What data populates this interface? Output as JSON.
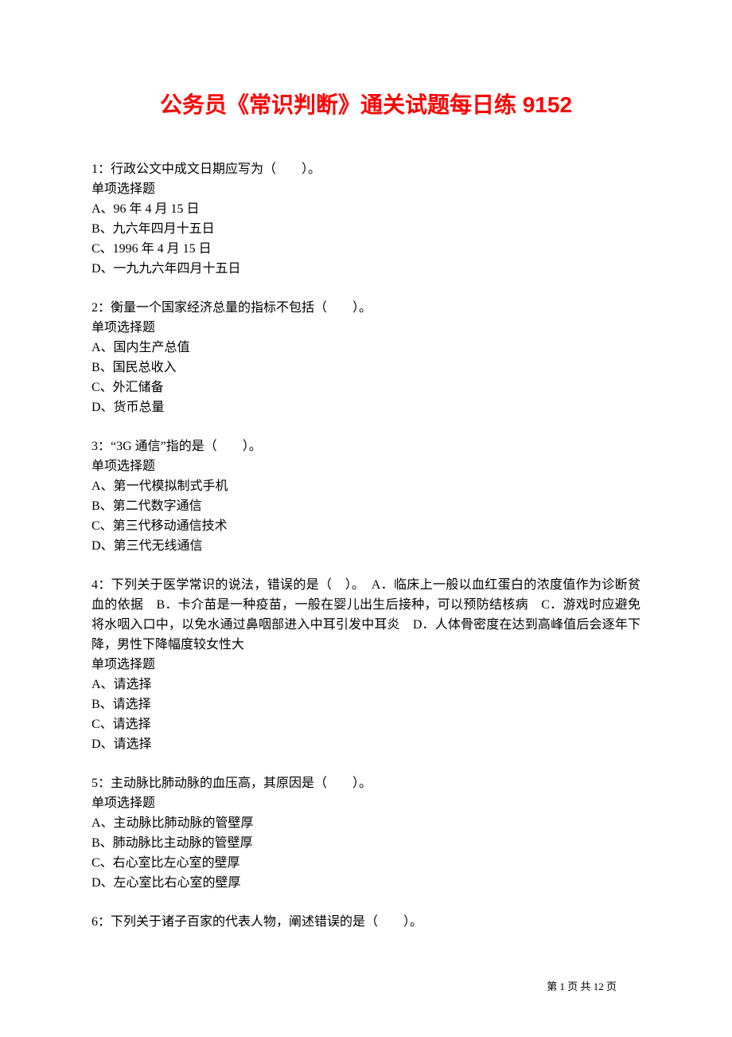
{
  "title": "公务员《常识判断》通关试题每日练 9152",
  "questions": [
    {
      "stem": "1：行政公文中成文日期应写为（　　）。",
      "type": "单项选择题",
      "options": [
        "A、96 年 4 月 15 日",
        "B、九六年四月十五日",
        "C、1996 年 4 月 15 日",
        "D、一九九六年四月十五日"
      ]
    },
    {
      "stem": "2：衡量一个国家经济总量的指标不包括（　　）。",
      "type": "单项选择题",
      "options": [
        "A、国内生产总值",
        "B、国民总收入",
        "C、外汇储备",
        "D、货币总量"
      ]
    },
    {
      "stem": "3：“3G 通信”指的是（　　）。",
      "type": "单项选择题",
      "options": [
        "A、第一代模拟制式手机",
        "B、第二代数字通信",
        "C、第三代移动通信技术",
        "D、第三代无线通信"
      ]
    },
    {
      "stem": "4：下列关于医学常识的说法，错误的是（　）。　A．临床上一般以血红蛋白的浓度值作为诊断贫血的依据　B．卡介苗是一种疫苗，一般在婴儿出生后接种，可以预防结核病　C．游戏时应避免将水咽入口中，以免水通过鼻咽部进入中耳引发中耳炎　D．人体骨密度在达到高峰值后会逐年下降，男性下降幅度较女性大",
      "type": "单项选择题",
      "options": [
        "A、请选择",
        "B、请选择",
        "C、请选择",
        "D、请选择"
      ]
    },
    {
      "stem": "5：主动脉比肺动脉的血压高，其原因是（　　）。",
      "type": "单项选择题",
      "options": [
        "A、主动脉比肺动脉的管壁厚",
        "B、肺动脉比主动脉的管壁厚",
        "C、右心室比左心室的壁厚",
        "D、左心室比右心室的壁厚"
      ]
    },
    {
      "stem": "6：下列关于诸子百家的代表人物，阐述错误的是（　　）。",
      "type": "",
      "options": []
    }
  ],
  "footer": "第 1 页 共 12 页"
}
